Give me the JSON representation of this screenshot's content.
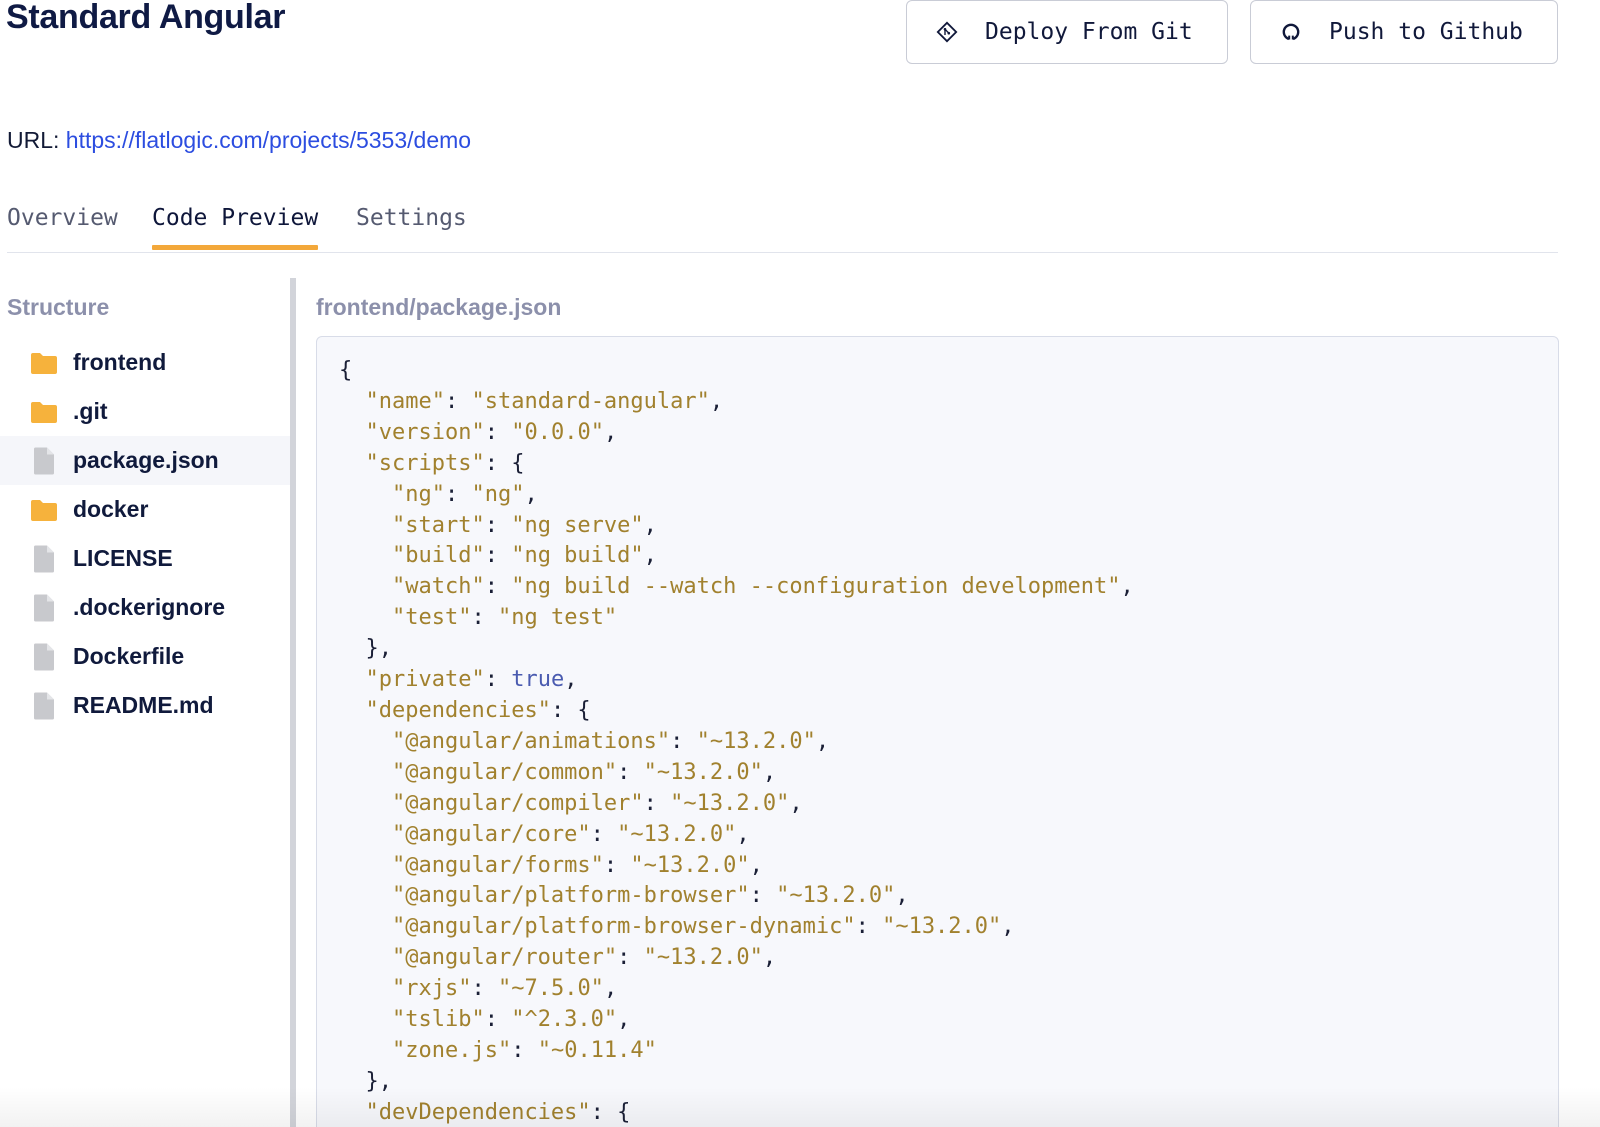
{
  "page": {
    "title": "Standard Angular"
  },
  "header": {
    "deploy_label": "Deploy From Git",
    "github_label": "Push to Github"
  },
  "url": {
    "label": "URL:",
    "href_text": "https://flatlogic.com/projects/5353/demo"
  },
  "tabs": [
    {
      "label": "Overview",
      "active": false
    },
    {
      "label": "Code Preview",
      "active": true
    },
    {
      "label": "Settings",
      "active": false
    }
  ],
  "sidebar": {
    "heading": "Structure",
    "items": [
      {
        "label": "frontend",
        "type": "folder",
        "selected": false
      },
      {
        "label": ".git",
        "type": "folder",
        "selected": false
      },
      {
        "label": "package.json",
        "type": "file",
        "selected": true
      },
      {
        "label": "docker",
        "type": "folder",
        "selected": false
      },
      {
        "label": "LICENSE",
        "type": "file",
        "selected": false
      },
      {
        "label": ".dockerignore",
        "type": "file",
        "selected": false
      },
      {
        "label": "Dockerfile",
        "type": "file",
        "selected": false
      },
      {
        "label": "README.md",
        "type": "file",
        "selected": false
      }
    ]
  },
  "code_view": {
    "file_path": "frontend/package.json",
    "lines": [
      "{",
      "  \"name\": \"standard-angular\",",
      "  \"version\": \"0.0.0\",",
      "  \"scripts\": {",
      "    \"ng\": \"ng\",",
      "    \"start\": \"ng serve\",",
      "    \"build\": \"ng build\",",
      "    \"watch\": \"ng build --watch --configuration development\",",
      "    \"test\": \"ng test\"",
      "  },",
      "  \"private\": true,",
      "  \"dependencies\": {",
      "    \"@angular/animations\": \"~13.2.0\",",
      "    \"@angular/common\": \"~13.2.0\",",
      "    \"@angular/compiler\": \"~13.2.0\",",
      "    \"@angular/core\": \"~13.2.0\",",
      "    \"@angular/forms\": \"~13.2.0\",",
      "    \"@angular/platform-browser\": \"~13.2.0\",",
      "    \"@angular/platform-browser-dynamic\": \"~13.2.0\",",
      "    \"@angular/router\": \"~13.2.0\",",
      "    \"rxjs\": \"~7.5.0\",",
      "    \"tslib\": \"^2.3.0\",",
      "    \"zone.js\": \"~0.11.4\"",
      "  },",
      "  \"devDependencies\": {"
    ]
  },
  "colors": {
    "accent_tab_underline": "#f3a83a",
    "link": "#2c4de0",
    "folder_icon": "#f6b23c",
    "file_icon": "#c8c9cd",
    "code_key": "#a1812e",
    "code_boolean": "#4a5bb0"
  },
  "icons": {
    "deploy": "git-diamond-icon",
    "github": "github-icon",
    "folder": "folder-icon",
    "file": "file-icon"
  }
}
